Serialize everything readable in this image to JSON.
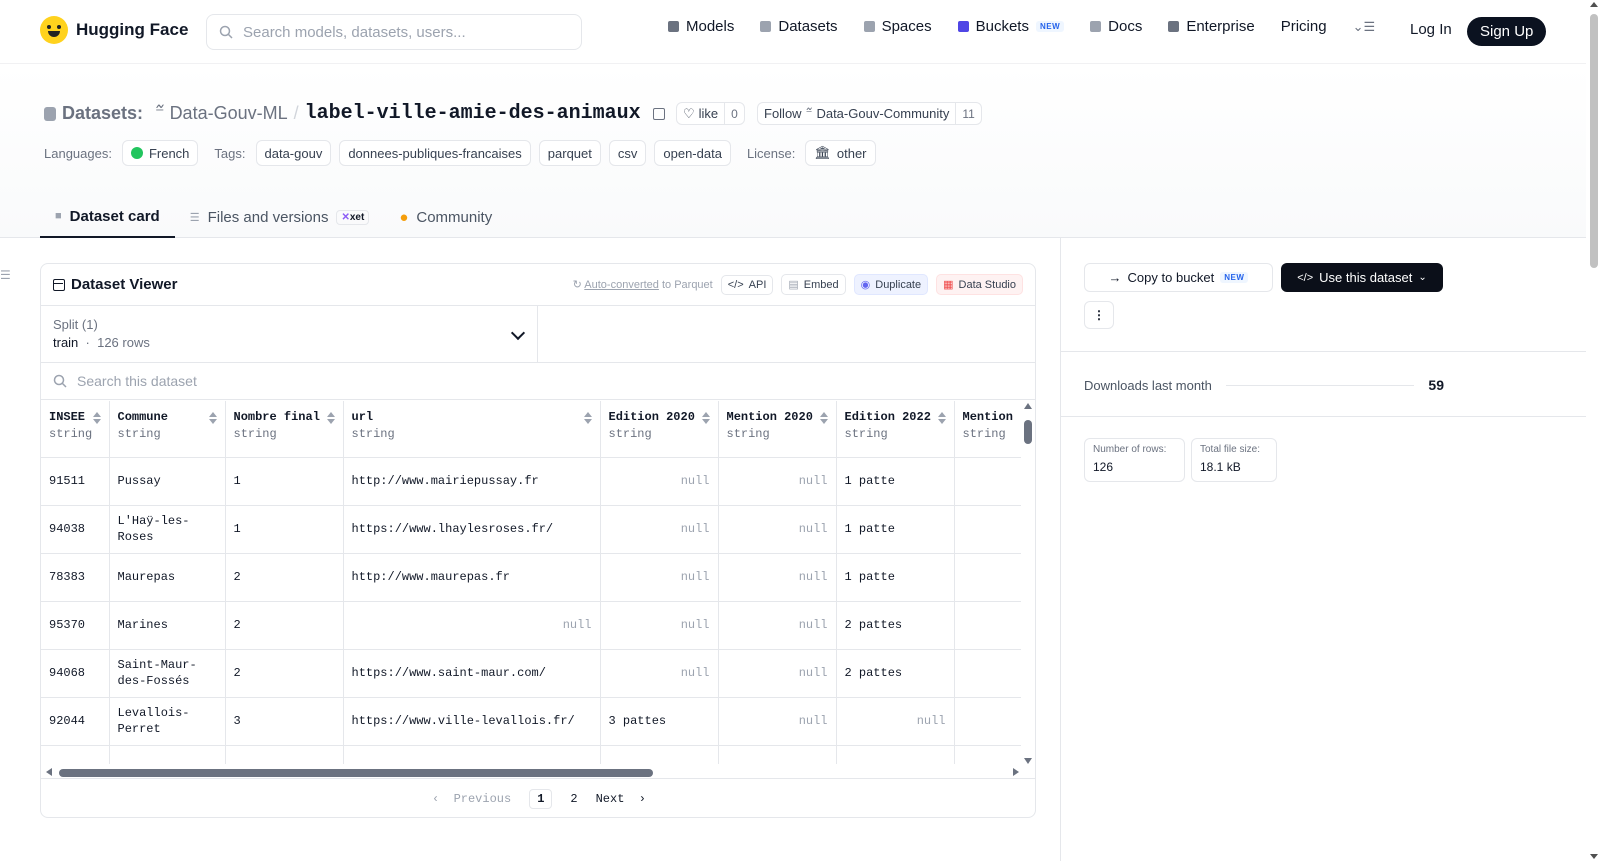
{
  "header": {
    "brand": "Hugging Face",
    "search_placeholder": "Search models, datasets, users...",
    "nav": [
      {
        "label": "Models",
        "icon": "cube-icon",
        "color": "#6b7280"
      },
      {
        "label": "Datasets",
        "icon": "database-icon",
        "color": "#9ca3af"
      },
      {
        "label": "Spaces",
        "icon": "grid-icon",
        "color": "#9ca3af"
      },
      {
        "label": "Buckets",
        "icon": "bucket-icon",
        "color": "#4f46e5",
        "badge": "NEW"
      },
      {
        "label": "Docs",
        "icon": "book-icon",
        "color": "#9ca3af"
      },
      {
        "label": "Enterprise",
        "icon": "enterprise-icon",
        "color": "#6b7280"
      },
      {
        "label": "Pricing"
      }
    ],
    "login": "Log In",
    "signup": "Sign Up"
  },
  "dataset": {
    "prefix": "Datasets:",
    "owner": "Data-Gouv-ML",
    "name": "label-ville-amie-des-animaux",
    "like_label": "like",
    "like_count": "0",
    "follow_label": "Follow",
    "follow_org": "Data-Gouv-Community",
    "follow_count": "11",
    "languages_label": "Languages:",
    "language": "French",
    "tags_label": "Tags:",
    "tags": [
      "data-gouv",
      "donnees-publiques-francaises",
      "parquet",
      "csv",
      "open-data"
    ],
    "license_label": "License:",
    "license": "other"
  },
  "tabs": [
    {
      "label": "Dataset card",
      "active": true
    },
    {
      "label": "Files and versions",
      "badge": "xet"
    },
    {
      "label": "Community"
    }
  ],
  "viewer": {
    "title": "Dataset Viewer",
    "auto_converted": "Auto-converted",
    "to_parquet": "to Parquet",
    "api": "API",
    "embed": "Embed",
    "duplicate": "Duplicate",
    "data_studio": "Data Studio",
    "split_label": "Split (1)",
    "split_value": "train",
    "split_rows": "126 rows",
    "search_placeholder": "Search this dataset",
    "columns": [
      {
        "name": "INSEE",
        "type": "string"
      },
      {
        "name": "Commune",
        "type": "string"
      },
      {
        "name": "Nombre final",
        "type": "string"
      },
      {
        "name": "url",
        "type": "string"
      },
      {
        "name": "Edition 2020",
        "type": "string"
      },
      {
        "name": "Mention 2020",
        "type": "string"
      },
      {
        "name": "Edition 2022",
        "type": "string"
      },
      {
        "name": "Mention",
        "type": "string"
      }
    ],
    "rows": [
      [
        "91511",
        "Pussay",
        "1",
        "http://www.mairiepussay.fr",
        "null",
        "null",
        "1 patte",
        ""
      ],
      [
        "94038",
        "L'Haÿ-les-Roses",
        "1",
        "https://www.lhaylesroses.fr/",
        "null",
        "null",
        "1 patte",
        ""
      ],
      [
        "78383",
        "Maurepas",
        "2",
        "http://www.maurepas.fr",
        "null",
        "null",
        "1 patte",
        ""
      ],
      [
        "95370",
        "Marines",
        "2",
        "null",
        "null",
        "null",
        "2 pattes",
        ""
      ],
      [
        "94068",
        "Saint-Maur-des-Fossés",
        "2",
        "https://www.saint-maur.com/",
        "null",
        "null",
        "2 pattes",
        ""
      ],
      [
        "92044",
        "Levallois-Perret",
        "3",
        "https://www.ville-levallois.fr/",
        "3 pattes",
        "null",
        "null",
        ""
      ],
      [
        "",
        "",
        "",
        "",
        "",
        "",
        "",
        ""
      ]
    ],
    "pager": {
      "previous": "Previous",
      "pages": [
        "1",
        "2"
      ],
      "current": "1",
      "next": "Next"
    }
  },
  "sidebar": {
    "copy_to_bucket": "Copy to bucket",
    "copy_badge": "NEW",
    "use_dataset": "Use this dataset",
    "downloads_label": "Downloads last month",
    "downloads_value": "59",
    "rows_label": "Number of rows:",
    "rows_value": "126",
    "size_label": "Total file size:",
    "size_value": "18.1 kB"
  }
}
